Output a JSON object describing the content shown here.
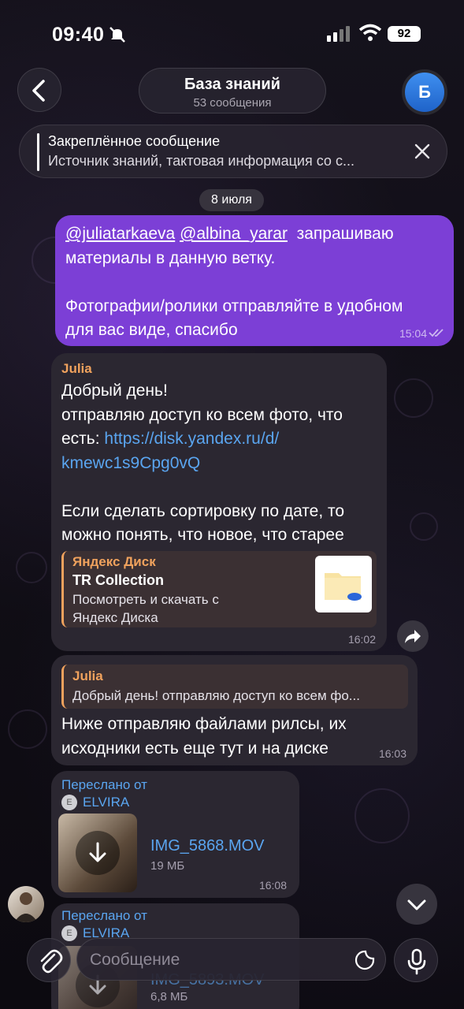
{
  "status_bar": {
    "time": "09:40",
    "battery": "92"
  },
  "header": {
    "title": "База знаний",
    "subtitle": "53 сообщения",
    "avatar_letter": "Б"
  },
  "pinned": {
    "label": "Закреплённое сообщение",
    "text": "Источник знаний, тактовая информация со с..."
  },
  "date_chip": "8 июля",
  "messages": [
    {
      "mention1": "@juliatarkaeva",
      "mention2": "@albina_yarar",
      "line1_rest": "  запрашиваю",
      "line2": "материалы в данную ветку.",
      "line3": "Фотографии/ролики отправляйте в удобном",
      "line4": "для вас виде, спасибо",
      "time": "15:04"
    },
    {
      "sender": "Julia",
      "line1": "Добрый день!",
      "line2": "отправляю доступ ко всем фото, что",
      "line3_prefix": "есть: ",
      "link1": "https://disk.yandex.ru/d/",
      "link2": "kmewc1s9Cpg0vQ",
      "line5": "Если сделать сортировку по дате, то",
      "line6": "можно понять, что новое, что старее",
      "preview": {
        "site": "Яндекс Диск",
        "title": "TR Collection",
        "desc1": "Посмотреть и скачать с",
        "desc2": "Яндекс Диска"
      },
      "time": "16:02"
    },
    {
      "reply_sender": "Julia",
      "reply_text": "Добрый день! отправляю доступ ко всем фо...",
      "line1": "Ниже отправляю файлами рилсы, их",
      "line2": "исходники есть еще тут и на диске",
      "time": "16:03"
    },
    {
      "forwarded_label": "Переслано от",
      "forwarded_from": "ELVIRA",
      "forwarded_initial": "E",
      "file_name": "IMG_5868.MOV",
      "file_size": "19 МБ",
      "time": "16:08"
    },
    {
      "forwarded_label": "Переслано от",
      "forwarded_from": "ELVIRA",
      "forwarded_initial": "E",
      "file_name": "IMG_5893.MOV",
      "file_size": "6,8 МБ"
    }
  ],
  "composer": {
    "placeholder": "Сообщение"
  }
}
